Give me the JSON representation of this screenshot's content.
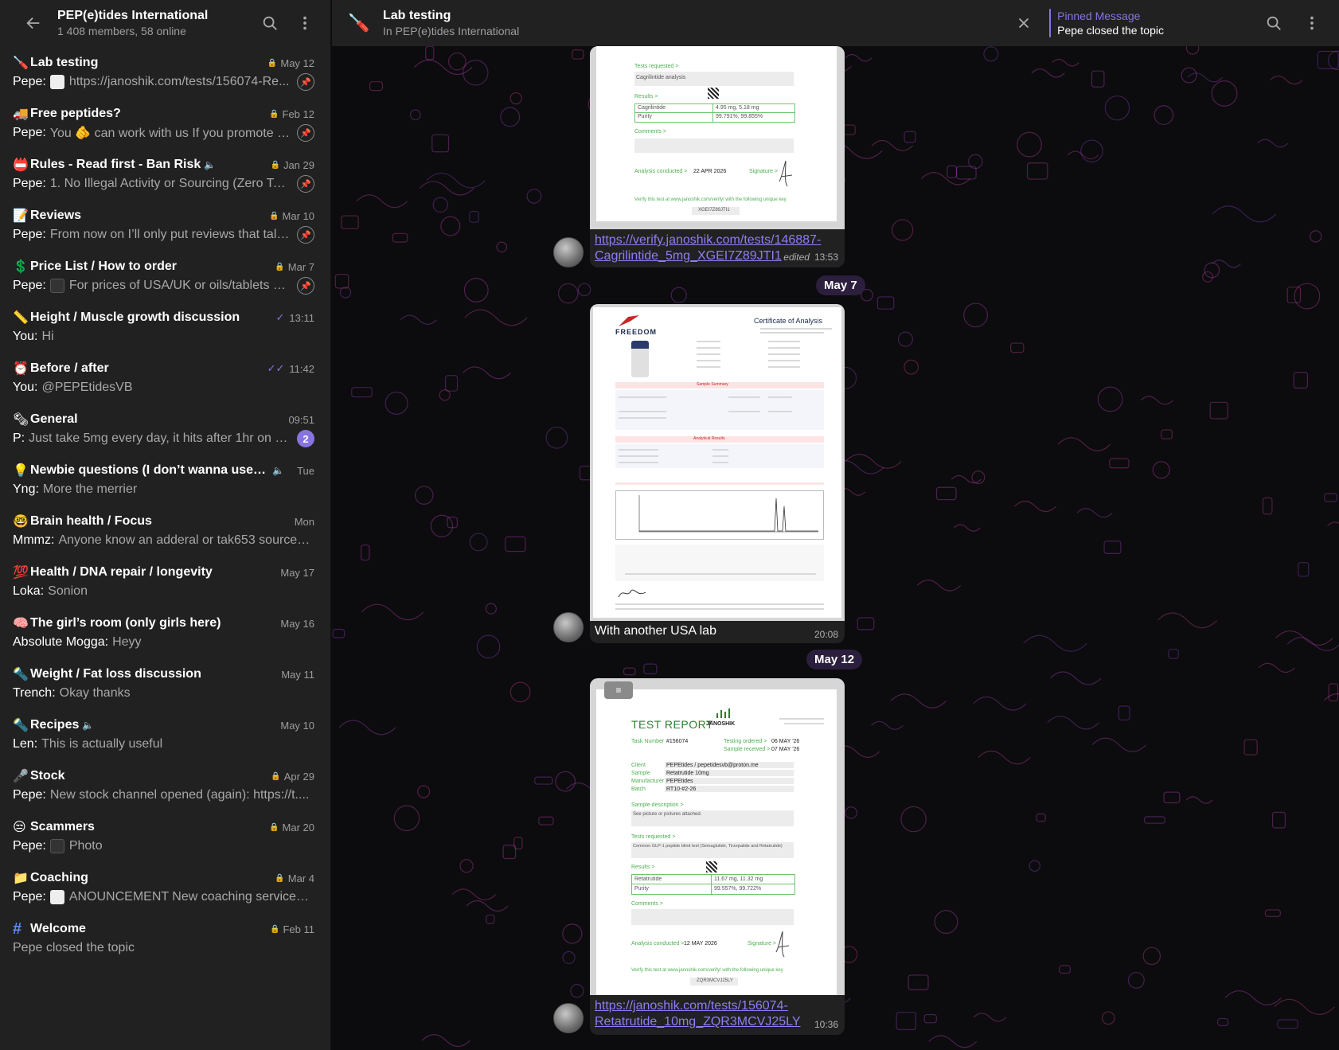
{
  "sidebar": {
    "title": "PEP(e)tides International",
    "subtitle": "1 408 members, 58 online",
    "topics": [
      {
        "emoji": "🪛",
        "name": "Lab testing",
        "date": "May 12",
        "locked": true,
        "sender": "Pepe:",
        "preview": "https://janoshik.com/tests/156074-Re...",
        "thumb": "light",
        "pinned": true
      },
      {
        "emoji": "🚚",
        "name": "Free peptides?",
        "date": "Feb 12",
        "locked": true,
        "sender": "Pepe:",
        "preview": "You 🫵 can work with us If you promote us...",
        "thumb": "",
        "pinned": true
      },
      {
        "emoji": "📛",
        "name": "Rules - Read first - Ban Risk",
        "muted": true,
        "date": "Jan 29",
        "locked": true,
        "sender": "Pepe:",
        "preview": "1. No Illegal Activity or Sourcing (Zero Tole...",
        "thumb": "",
        "pinned": true
      },
      {
        "emoji": "📝",
        "name": "Reviews",
        "date": "Mar 10",
        "locked": true,
        "sender": "Pepe:",
        "preview": "From now on I’ll only put reviews that talk ...",
        "thumb": "",
        "pinned": true
      },
      {
        "emoji": "💲",
        "name": "Price List / How to order",
        "date": "Mar 7",
        "locked": true,
        "sender": "Pepe:",
        "preview": "For prices of USA/UK or oils/tablets pl...",
        "thumb": "dark",
        "pinned": true
      },
      {
        "emoji": "📏",
        "name": "Height / Muscle growth discussion",
        "date": "13:11",
        "check": "✓",
        "sender": "You:",
        "preview": "Hi"
      },
      {
        "emoji": "⏰",
        "name": "Before / after",
        "date": "11:42",
        "check": "✓✓",
        "sender": "You:",
        "preview": "@PEPEtidesVB"
      },
      {
        "emoji": "🗞",
        "name": "General",
        "date": "09:51",
        "sender": "P:",
        "preview": "Just take 5mg every day, it hits after 1hr on e...",
        "badge": "2"
      },
      {
        "emoji": "💡",
        "name": "Newbie questions (I don’t wanna use Cha...",
        "muted": true,
        "date": "Tue",
        "sender": "Yng:",
        "preview": "More the merrier"
      },
      {
        "emoji": "🤓",
        "name": "Brain health / Focus",
        "date": "Mon",
        "sender": "Mmmz:",
        "preview": "Anyone know an adderal or tak653 source? ..."
      },
      {
        "emoji": "💯",
        "name": "Health / DNA repair / longevity",
        "date": "May 17",
        "sender": "Loka:",
        "preview": "Sonion"
      },
      {
        "emoji": "🧠",
        "name": "The girl’s room (only girls here)",
        "date": "May 16",
        "sender": "Absolute Mogga:",
        "preview": "Heyy"
      },
      {
        "emoji": "🔦",
        "name": "Weight / Fat loss discussion",
        "date": "May 11",
        "sender": "Trench:",
        "preview": "Okay thanks"
      },
      {
        "emoji": "🔦",
        "name": "Recipes",
        "muted": true,
        "date": "May 10",
        "sender": "Len:",
        "preview": "This is actually useful"
      },
      {
        "emoji": "🎤",
        "name": "Stock",
        "date": "Apr 29",
        "locked": true,
        "sender": "Pepe:",
        "preview": "New stock channel opened (again): https://t...."
      },
      {
        "emoji": "😒",
        "name": "Scammers",
        "date": "Mar 20",
        "locked": true,
        "sender": "Pepe:",
        "preview": "Photo",
        "thumb": "dark"
      },
      {
        "emoji": "📁",
        "name": "Coaching",
        "date": "Mar 4",
        "locked": true,
        "sender": "Pepe:",
        "preview": "ANOUNCEMENT New coaching services a...",
        "thumb": "light"
      },
      {
        "emoji": "#",
        "name": "Welcome",
        "date": "Feb 11",
        "locked": true,
        "sender": "",
        "preview": "Pepe closed the topic",
        "hash": true
      }
    ]
  },
  "chat": {
    "title": "Lab testing",
    "subtitle": "In PEP(e)tides International",
    "pinned_title": "Pinned Message",
    "pinned_text": "Pepe closed the topic"
  },
  "messages": {
    "m1": {
      "link_line1": "https://verify.janoshik.com/tests/146887-",
      "link_line2": "Cagrilintide_5mg_XGEI7Z89JTI1",
      "edited": "edited",
      "time": "13:53",
      "doc": {
        "tests_requested": "Tests requested >",
        "analysis": "Cagrilintide analysis",
        "results": "Results >",
        "row1a": "Cagrilintide",
        "row1b": "4.95 mg, 5.18 mg",
        "row2a": "Purity",
        "row2b": "99.791%, 99.855%",
        "comments": "Comments >",
        "analysis_conducted": "Analysis conducted >",
        "analysis_date": "22 APR 2026",
        "signature": "Signature >",
        "verify": "Verify this test at www.janoshik.com/verify/ with the following unique key",
        "key": "XGEI7Z89JTI1"
      }
    },
    "date1": "May 7",
    "m2": {
      "caption": "With another USA lab",
      "time": "20:08",
      "doc": {
        "brand": "FREEDOM",
        "coa": "Certificate of Analysis",
        "sample_summary": "Sample Summary",
        "analytical_results": "Analytical Results"
      }
    },
    "date2": "May 12",
    "m3": {
      "link_line1": "https://janoshik.com/tests/156074-",
      "link_line2": "Retatrutide_10mg_ZQR3MCVJ25LY",
      "time": "10:36",
      "doc": {
        "title": "TEST REPORT",
        "brand": "JANOSHIK",
        "task_label": "Task Number",
        "task": "#156074",
        "testing_ordered": "Testing ordered >",
        "ordered_date": "06 MAY '26",
        "sample_received": "Sample received >",
        "received_date": "07 MAY '26",
        "client_label": "Client",
        "client": "PEPEtides / pepetidesvb@proton.me",
        "sample_label": "Sample",
        "sample": "Retatrutide 10mg",
        "manufacturer_label": "Manufacturer",
        "manufacturer": "PEPEtides",
        "batch_label": "Batch",
        "batch": "RT10-#2-26",
        "sample_desc": "Sample description >",
        "see_picture": "See picture or pictures attached.",
        "tests_requested": "Tests requested >",
        "tests": "Common GLP-1 peptide blind test (Semaglutide, Tirzepatide and Retatrutide)",
        "results": "Results >",
        "row1a": "Retatrutide",
        "row1b": "11.67 mg, 11.32 mg",
        "row2a": "Purity",
        "row2b": "99.557%, 99.722%",
        "comments": "Comments >",
        "analysis_conducted": "Analysis conducted >",
        "analysis_date": "12 MAY 2026",
        "signature": "Signature >",
        "verify": "Verify this test at www.janoshik.com/verify/ with the following unique key",
        "key": "ZQR3MCVJ25LY"
      }
    }
  }
}
